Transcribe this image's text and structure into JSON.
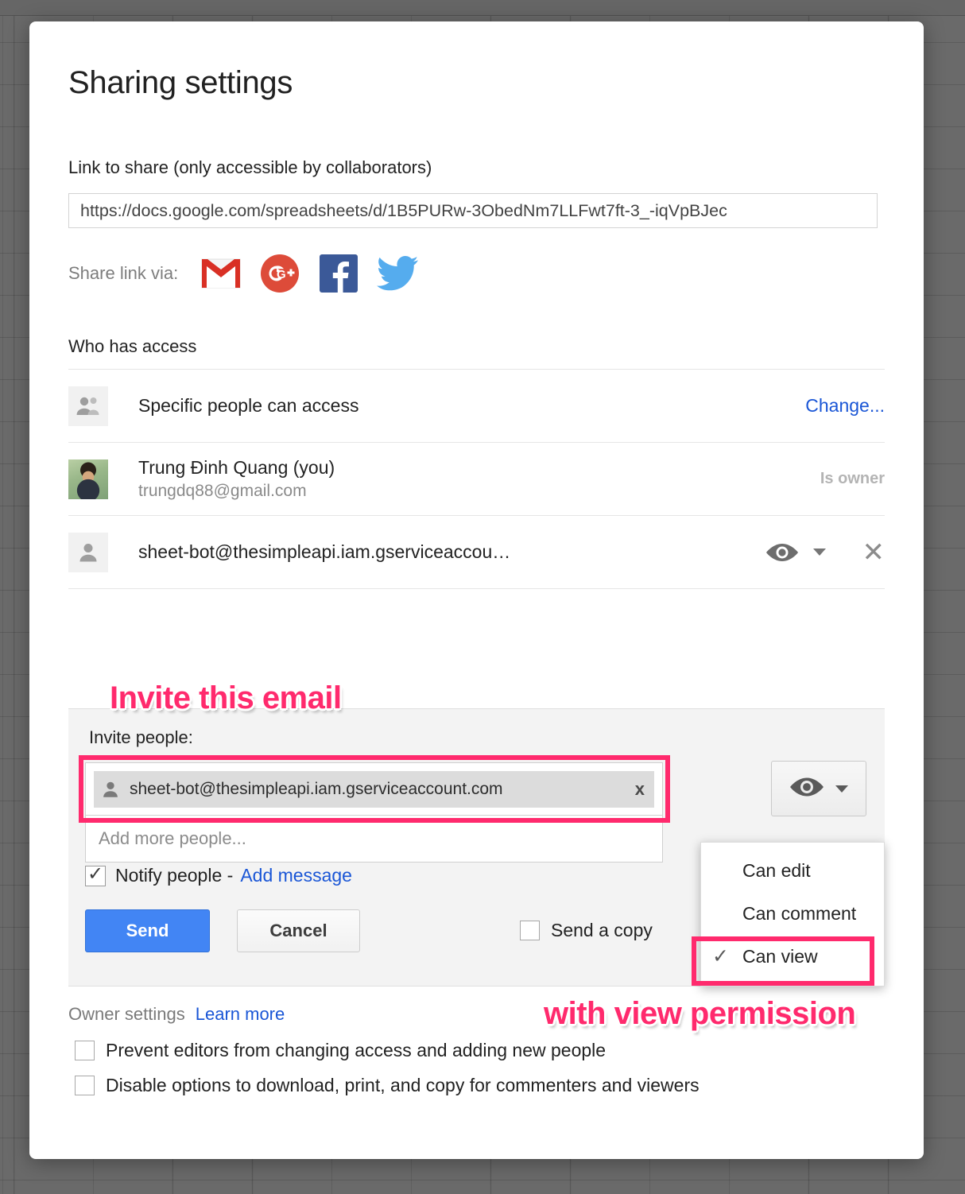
{
  "dialog": {
    "title": "Sharing settings"
  },
  "link_section": {
    "label": "Link to share (only accessible by collaborators)",
    "url": "https://docs.google.com/spreadsheets/d/1B5PURw-3ObedNm7LLFwt7ft-3_-iqVpBJec",
    "share_via_label": "Share link via:",
    "social": [
      {
        "name": "gmail-icon",
        "label": "Gmail"
      },
      {
        "name": "google-plus-icon",
        "label": "Google+"
      },
      {
        "name": "facebook-icon",
        "label": "Facebook"
      },
      {
        "name": "twitter-icon",
        "label": "Twitter"
      }
    ]
  },
  "access_section": {
    "heading": "Who has access",
    "rows": [
      {
        "icon": "people-icon",
        "name": "Specific people can access",
        "sub": "",
        "right_label": "Change...",
        "right_type": "link"
      },
      {
        "icon": "avatar-photo",
        "name": "Trung Đinh Quang (you)",
        "sub": "trungdq88@gmail.com",
        "right_label": "Is owner",
        "right_type": "text"
      },
      {
        "icon": "person-icon",
        "name": "sheet-bot@thesimpleapi.iam.gserviceaccou…",
        "sub": "",
        "right_label": "",
        "right_type": "eye-dropdown-remove"
      }
    ]
  },
  "invite_section": {
    "label": "Invite people:",
    "chip": {
      "email": "sheet-bot@thesimpleapi.iam.gserviceaccount.com",
      "remove_label": "x"
    },
    "add_more_placeholder": "Add more people...",
    "notify_label": "Notify people -",
    "add_message_label": "Add message",
    "send_label": "Send",
    "cancel_label": "Cancel",
    "send_copy_label": "Send a copy",
    "permission_icon": "eye-icon"
  },
  "permission_menu": {
    "items": [
      {
        "label": "Can edit",
        "checked": false
      },
      {
        "label": "Can comment",
        "checked": false
      },
      {
        "label": "Can view",
        "checked": true
      }
    ],
    "check_glyph": "✓"
  },
  "owner_settings": {
    "title": "Owner settings",
    "learn_more": "Learn more",
    "checkboxes": [
      "Prevent editors from changing access and adding new people",
      "Disable options to download, print, and copy for commenters and viewers"
    ]
  },
  "annotations": [
    {
      "text": "Invite this email"
    },
    {
      "text": "with view permission"
    }
  ],
  "colors": {
    "annotation_pink": "#ff2a6d",
    "link_blue": "#1a56d6",
    "send_blue": "#4285f4",
    "backdrop": "#6a6a6a"
  }
}
